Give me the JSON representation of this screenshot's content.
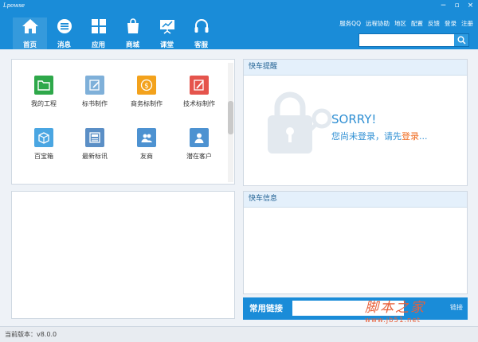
{
  "window": {
    "logo_text": "Lpowse",
    "controls": [
      "−",
      "▫",
      "×"
    ]
  },
  "nav": {
    "items": [
      {
        "label": "首页",
        "icon": "home-icon"
      },
      {
        "label": "消息",
        "icon": "message-icon"
      },
      {
        "label": "应用",
        "icon": "apps-grid-icon"
      },
      {
        "label": "商城",
        "icon": "shopping-bag-icon"
      },
      {
        "label": "课堂",
        "icon": "presentation-icon"
      },
      {
        "label": "客服",
        "icon": "headset-icon"
      }
    ]
  },
  "top_links": [
    "服务QQ",
    "远程协助",
    "地区",
    "配置",
    "反馈",
    "登录",
    "注册"
  ],
  "search": {
    "placeholder": "",
    "value": "",
    "icon": "search-icon"
  },
  "apps": [
    {
      "label": "我的工程",
      "icon": "folder-icon",
      "color": "#2ea84a"
    },
    {
      "label": "标书制作",
      "icon": "edit-document-icon",
      "color": "#7fb0d9"
    },
    {
      "label": "商务标制作",
      "icon": "dollar-coin-icon",
      "color": "#f3a21c"
    },
    {
      "label": "技术标制作",
      "icon": "edit-pen-icon",
      "color": "#e5544c"
    },
    {
      "label": "百宝箱",
      "icon": "box-icon",
      "color": "#4aa6e2"
    },
    {
      "label": "最新标讯",
      "icon": "news-icon",
      "color": "#5b8fc6"
    },
    {
      "label": "友商",
      "icon": "users-icon",
      "color": "#4d92d1"
    },
    {
      "label": "潜在客户",
      "icon": "user-icon",
      "color": "#4d92d1"
    }
  ],
  "reminder": {
    "title": "快车提醒",
    "sorry_title": "SORRY!",
    "sorry_msg_prefix": "您尚未登录，请先",
    "sorry_msg_link": "登录",
    "sorry_msg_suffix": "..."
  },
  "info": {
    "title": "快车信息"
  },
  "links": {
    "label": "常用链接",
    "button": "链接"
  },
  "status": {
    "version": "当前版本：v8.0.0"
  },
  "watermark": {
    "text": "脚本之家",
    "url": "www.jb51.net"
  },
  "colors": {
    "accent": "#1a8cd8",
    "link_orange": "#ef6a1e"
  }
}
